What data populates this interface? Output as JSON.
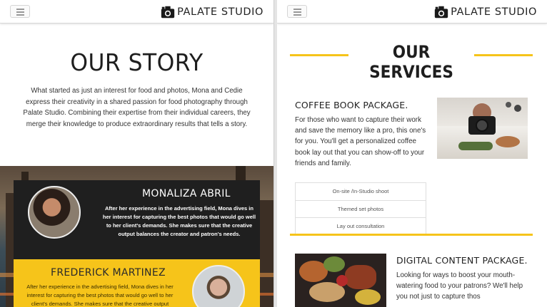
{
  "brand": {
    "name": "PALATE STUDIO",
    "logo_icon": "camera-icon"
  },
  "story": {
    "title": "OUR STORY",
    "body": "What started as just an interest for food and photos, Mona and Cedie express their creativity in a shared passion for food photography through Palate Studio. Combining their expertise from their individual careers, they merge their knowledge to produce extraordinary results that tells a story."
  },
  "team": [
    {
      "name": "MONALIZA ABRIL",
      "bio": "After her experience in the advertising field, Mona dives in her interest for capturing the best photos that would go well to her client's demands. She makes sure that the creative output balances the creator and patron's needs."
    },
    {
      "name": "FREDERICK MARTINEZ",
      "bio": "After her experience in the advertising field, Mona dives in her interest for capturing the best photos that would go well to her client's demands. She makes sure that the creative output balances the creator and patron's needs."
    }
  ],
  "services": {
    "title": "OUR SERVICES",
    "packages": [
      {
        "title": "COFFEE BOOK PACKAGE.",
        "description": "For those who want to capture their work and save the memory like a pro, this one's for you. You'll get a personalized coffee book lay out that you can show-off to your friends and family.",
        "features": [
          "On-site /In-Studio shoot",
          "Themed set photos",
          "Lay out consultation"
        ]
      },
      {
        "title": "DIGITAL CONTENT PACKAGE.",
        "description": "Looking for ways to boost your mouth-watering food to your patrons? We'll help you not just to capture thos"
      }
    ]
  },
  "colors": {
    "accent": "#f6c41a",
    "dark_card": "#1f1f1f"
  }
}
